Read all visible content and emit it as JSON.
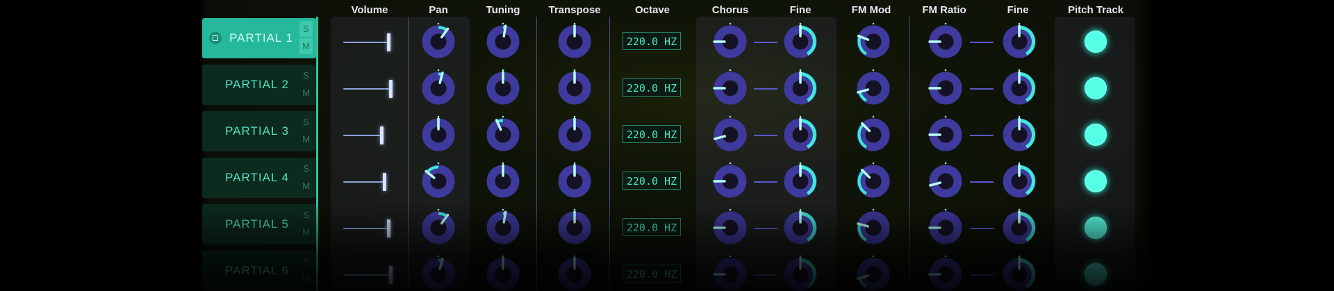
{
  "colors": {
    "accent": "#26b89a",
    "knob_ring": "#3f3a9e",
    "knob_indicator": "#3ee9d6",
    "led": "#54ffe6",
    "divider": "#5a58c8"
  },
  "headers": {
    "volume": "Volume",
    "pan": "Pan",
    "tuning": "Tuning",
    "transpose": "Transpose",
    "octave": "Octave",
    "chorus": "Chorus",
    "chorus_fine": "Fine",
    "fm_mod": "FM Mod",
    "fm_ratio": "FM Ratio",
    "fm_fine": "Fine",
    "pitch_track": "Pitch Track"
  },
  "solo_label": "S",
  "mute_label": "M",
  "partials": [
    {
      "name": "PARTIAL 1",
      "selected": true,
      "volume": 0.92,
      "pan": 0.62,
      "tuning": 0.53,
      "transpose": 0.5,
      "octave": "220.0 HZ",
      "chorus": 0.2,
      "chorus_fine": 0.5,
      "fm_mod": 0.27,
      "fm_ratio": 0.2,
      "fm_fine": 0.5,
      "pitch_track": true
    },
    {
      "name": "PARTIAL 2",
      "selected": false,
      "volume": 0.96,
      "pan": 0.55,
      "tuning": 0.5,
      "transpose": 0.5,
      "octave": "220.0 HZ",
      "chorus": 0.2,
      "chorus_fine": 0.5,
      "fm_mod": 0.15,
      "fm_ratio": 0.2,
      "fm_fine": 0.5,
      "pitch_track": true
    },
    {
      "name": "PARTIAL 3",
      "selected": false,
      "volume": 0.78,
      "pan": 0.5,
      "tuning": 0.42,
      "transpose": 0.5,
      "octave": "220.0 HZ",
      "chorus": 0.15,
      "chorus_fine": 0.5,
      "fm_mod": 0.35,
      "fm_ratio": 0.2,
      "fm_fine": 0.5,
      "pitch_track": true
    },
    {
      "name": "PARTIAL 4",
      "selected": false,
      "volume": 0.84,
      "pan": 0.33,
      "tuning": 0.5,
      "transpose": 0.5,
      "octave": "220.0 HZ",
      "chorus": 0.2,
      "chorus_fine": 0.5,
      "fm_mod": 0.35,
      "fm_ratio": 0.15,
      "fm_fine": 0.5,
      "pitch_track": true
    },
    {
      "name": "PARTIAL 5",
      "selected": false,
      "volume": 0.92,
      "pan": 0.62,
      "tuning": 0.53,
      "transpose": 0.5,
      "octave": "220.0 HZ",
      "chorus": 0.2,
      "chorus_fine": 0.5,
      "fm_mod": 0.25,
      "fm_ratio": 0.2,
      "fm_fine": 0.5,
      "pitch_track": true
    },
    {
      "name": "PARTIAL 6",
      "selected": false,
      "volume": 0.96,
      "pan": 0.55,
      "tuning": 0.5,
      "transpose": 0.5,
      "octave": "220.0 HZ",
      "chorus": 0.2,
      "chorus_fine": 0.5,
      "fm_mod": 0.15,
      "fm_ratio": 0.2,
      "fm_fine": 0.5,
      "pitch_track": true
    }
  ]
}
